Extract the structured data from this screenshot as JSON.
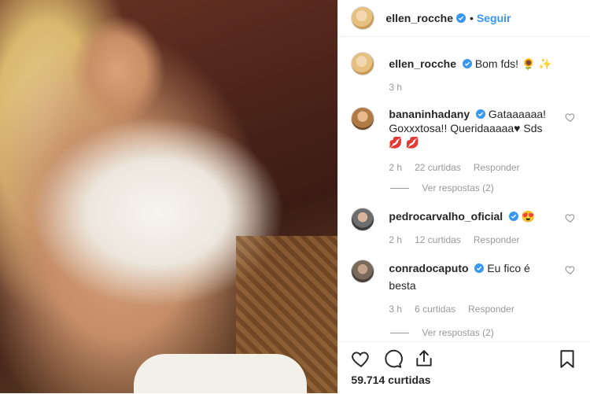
{
  "header": {
    "username": "ellen_rocche",
    "separator": "•",
    "follow_label": "Seguir"
  },
  "caption": {
    "username": "ellen_rocche",
    "text": "Bom fds!",
    "emojis": "🌻 ✨",
    "time": "3 h"
  },
  "comments": [
    {
      "username": "bananinhadany",
      "text": "Gataaaaaa! Goxxxtosa!! Queridaaaaa♥ Sds",
      "emojis": "💋 💋",
      "time": "2 h",
      "likes": "22 curtidas",
      "reply": "Responder",
      "view_replies": "Ver respostas (2)"
    },
    {
      "username": "pedrocarvalho_oficial",
      "text": "",
      "emojis": "😍",
      "time": "2 h",
      "likes": "12 curtidas",
      "reply": "Responder"
    },
    {
      "username": "conradocaputo",
      "text": "Eu fico é besta",
      "emojis": "",
      "time": "3 h",
      "likes": "6 curtidas",
      "reply": "Responder",
      "view_replies": "Ver respostas (2)"
    }
  ],
  "footer": {
    "likes": "59.714 curtidas"
  },
  "colors": {
    "link": "#3897f0",
    "muted": "#999999",
    "verified": "#3897f0"
  }
}
